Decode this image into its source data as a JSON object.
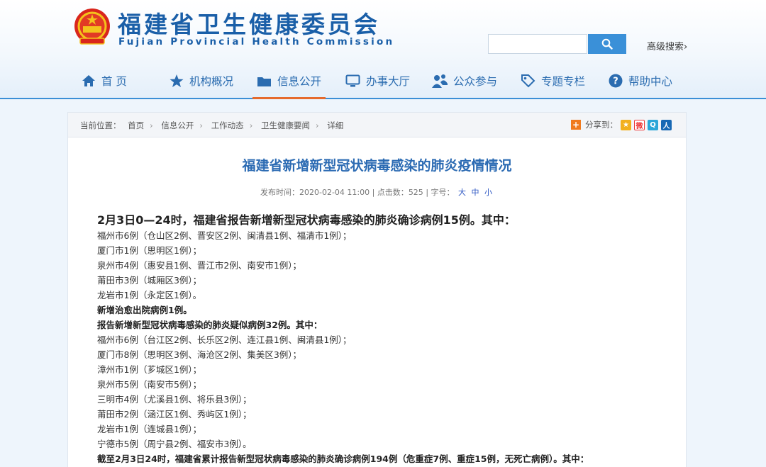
{
  "header": {
    "title": "福建省卫生健康委员会",
    "subtitle": "Fujian Provincial Health Commission",
    "search_placeholder": "",
    "advanced_search": "高级搜索›"
  },
  "nav": {
    "items": [
      {
        "label": "首 页",
        "icon": "home-icon"
      },
      {
        "label": "机构概况",
        "icon": "star-icon"
      },
      {
        "label": "信息公开",
        "icon": "folder-icon"
      },
      {
        "label": "办事大厅",
        "icon": "monitor-icon"
      },
      {
        "label": "公众参与",
        "icon": "people-icon"
      },
      {
        "label": "专题专栏",
        "icon": "tag-icon"
      },
      {
        "label": "帮助中心",
        "icon": "help-icon"
      }
    ],
    "active_index": 2
  },
  "breadcrumb": {
    "prefix": "当前位置：",
    "items": [
      "首页",
      "信息公开",
      "工作动态",
      "卫生健康要闻",
      "详细"
    ]
  },
  "share": {
    "label": "分享到：",
    "targets": [
      "qzone-icon",
      "weibo-icon",
      "tencent-weibo-icon",
      "renren-icon"
    ]
  },
  "article": {
    "title": "福建省新增新型冠状病毒感染的肺炎疫情情况",
    "publish_label": "发布时间：",
    "publish_time": "2020-02-04 11:00",
    "clicks_label": "点击数：",
    "clicks": "525",
    "font_label": "字号：",
    "font_sizes": [
      "大",
      "中",
      "小"
    ],
    "lines": [
      {
        "text": "2月3日0—24时，福建省报告新增新型冠状病毒感染的肺炎确诊病例15例。其中：",
        "style": "lead"
      },
      {
        "text": "福州市6例（仓山区2例、晋安区2例、闽清县1例、福清市1例）；",
        "style": "normal"
      },
      {
        "text": "厦门市1例（思明区1例）；",
        "style": "normal"
      },
      {
        "text": "泉州市4例（惠安县1例、晋江市2例、南安市1例）；",
        "style": "normal"
      },
      {
        "text": "莆田市3例（城厢区3例）；",
        "style": "normal"
      },
      {
        "text": "龙岩市1例（永定区1例）。",
        "style": "normal"
      },
      {
        "text": "新增治愈出院病例1例。",
        "style": "bold"
      },
      {
        "text": "报告新增新型冠状病毒感染的肺炎疑似病例32例。其中：",
        "style": "bold"
      },
      {
        "text": "福州市6例（台江区2例、长乐区2例、连江县1例、闽清县1例）；",
        "style": "normal"
      },
      {
        "text": "厦门市8例（思明区3例、海沧区2例、集美区3例）；",
        "style": "normal"
      },
      {
        "text": "漳州市1例（芗城区1例）；",
        "style": "normal"
      },
      {
        "text": "泉州市5例（南安市5例）；",
        "style": "normal"
      },
      {
        "text": "三明市4例（尤溪县1例、将乐县3例）；",
        "style": "normal"
      },
      {
        "text": "莆田市2例（涵江区1例、秀屿区1例）；",
        "style": "normal"
      },
      {
        "text": "龙岩市1例（连城县1例）；",
        "style": "normal"
      },
      {
        "text": "宁德市5例（周宁县2例、福安市3例）。",
        "style": "normal"
      },
      {
        "text": "截至2月3日24时，福建省累计报告新型冠状病毒感染的肺炎确诊病例194例（危重症7例、重症15例，无死亡病例）。其中：",
        "style": "bold"
      }
    ]
  },
  "colors": {
    "brand_blue": "#1a5fa8",
    "nav_blue": "#2b6cb0",
    "title_blue": "#2c6bb3",
    "active_underline": "#e56a2c",
    "search_button": "#3a90d8"
  }
}
